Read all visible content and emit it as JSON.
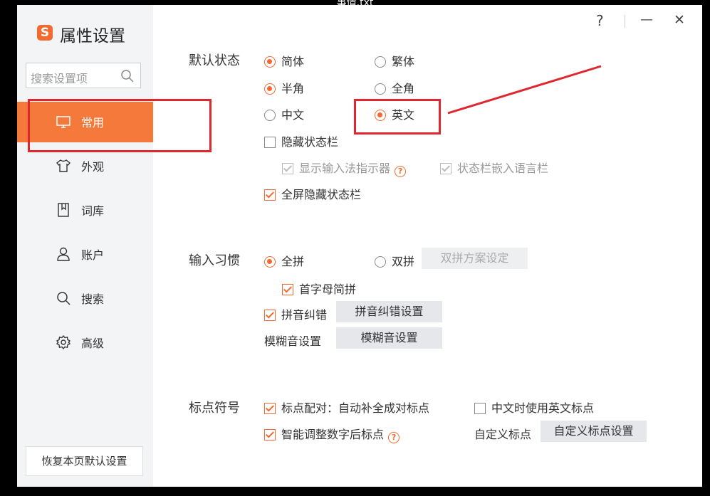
{
  "window": {
    "titlebar_text": "事情.txt",
    "title": "属性设置",
    "logo_glyph": "S"
  },
  "controls": {
    "help": "?",
    "minimize": "—",
    "close": "✕"
  },
  "search": {
    "placeholder": "搜索设置项"
  },
  "sidebar": {
    "items": [
      {
        "label": "常用",
        "icon": "monitor-icon",
        "active": true
      },
      {
        "label": "外观",
        "icon": "shirt-icon"
      },
      {
        "label": "词库",
        "icon": "book-icon"
      },
      {
        "label": "账户",
        "icon": "user-icon"
      },
      {
        "label": "搜索",
        "icon": "search-icon"
      },
      {
        "label": "高级",
        "icon": "gear-icon"
      }
    ],
    "restore_label": "恢复本页默认设置"
  },
  "sections": {
    "default_state": {
      "label": "默认状态",
      "simplified": "简体",
      "traditional": "繁体",
      "halfwidth": "半角",
      "fullwidth": "全角",
      "chinese": "中文",
      "english": "英文",
      "hide_statusbar": "隐藏状态栏",
      "show_indicator": "显示输入法指示器",
      "embed_langbar": "状态栏嵌入语言栏",
      "fullscreen_hide": "全屏隐藏状态栏"
    },
    "input_habit": {
      "label": "输入习惯",
      "quanpin": "全拼",
      "shuangpin": "双拼",
      "shuangpin_btn": "双拼方案设定",
      "initial_jianpin": "首字母简拼",
      "pinyin_correct": "拼音纠错",
      "pinyin_correct_btn": "拼音纠错设置",
      "fuzzy_label": "模糊音设置",
      "fuzzy_btn": "模糊音设置"
    },
    "punctuation": {
      "label": "标点符号",
      "pair": "标点配对：自动补全成对标点",
      "english_punct": "中文时使用英文标点",
      "smart_adjust": "智能调整数字后标点",
      "custom_label": "自定义标点",
      "custom_btn": "自定义标点设置"
    }
  },
  "colors": {
    "accent": "#f4793b",
    "annotation": "#e0262f"
  }
}
